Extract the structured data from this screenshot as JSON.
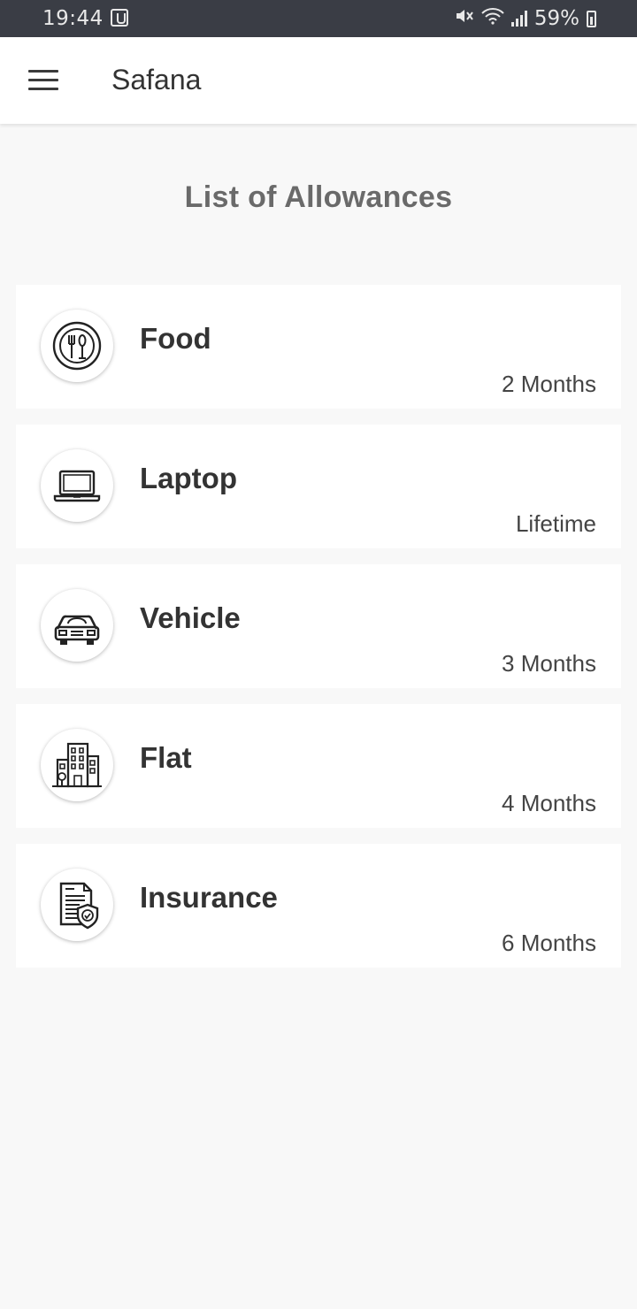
{
  "status_bar": {
    "time": "19:44",
    "battery_text": "59%",
    "icons": [
      "notification-hand-icon",
      "mute-icon",
      "wifi-icon",
      "signal-icon",
      "battery-charging-icon"
    ]
  },
  "app_bar": {
    "menu_icon": "hamburger-menu-icon",
    "title": "Safana"
  },
  "page": {
    "heading": "List of Allowances"
  },
  "allowances": [
    {
      "icon": "food-icon",
      "name": "Food",
      "duration": "2 Months"
    },
    {
      "icon": "laptop-icon",
      "name": "Laptop",
      "duration": "Lifetime"
    },
    {
      "icon": "vehicle-icon",
      "name": "Vehicle",
      "duration": "3 Months"
    },
    {
      "icon": "flat-icon",
      "name": "Flat",
      "duration": "4 Months"
    },
    {
      "icon": "insurance-icon",
      "name": "Insurance",
      "duration": "6 Months"
    }
  ]
}
